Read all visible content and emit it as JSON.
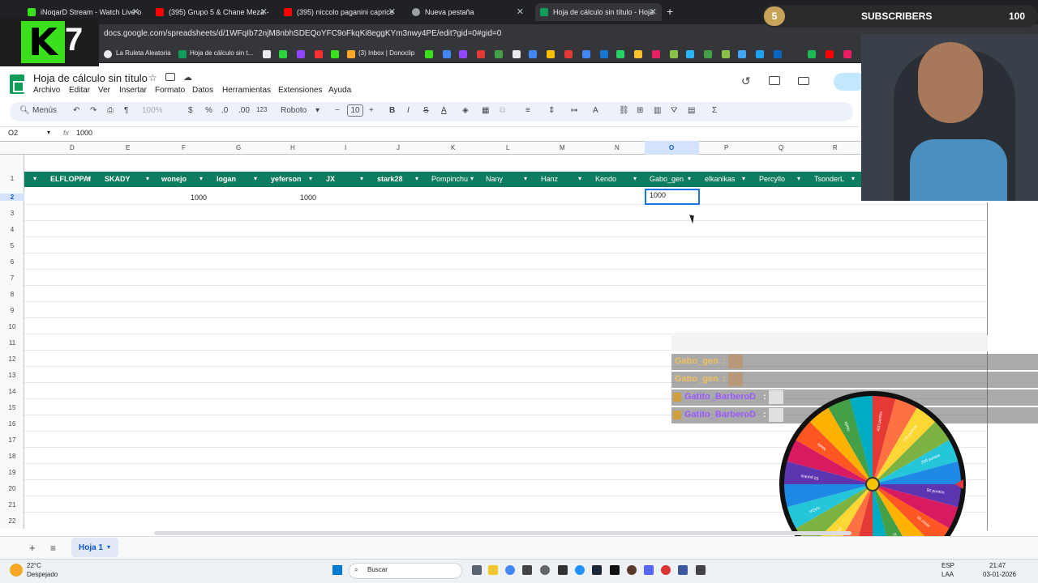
{
  "browser": {
    "tabs": [
      {
        "label": "iNoqarD Stream - Watch Live o",
        "color": "#39e01b"
      },
      {
        "label": "(395) Grupo 5 & Chane Meza -",
        "color": "#ff0000"
      },
      {
        "label": "(395) niccolo paganini caprice",
        "color": "#ff0000"
      },
      {
        "label": "Nueva pestaña",
        "color": "#9aa0a6"
      },
      {
        "label": "Hoja de cálculo sin título - Hoja",
        "color": "#0f9d58"
      }
    ],
    "url": "docs.google.com/spreadsheets/d/1WFqIb72njM8nbhSDEQoYFC9oFkqKi8eggKYm3nwy4PE/edit?gid=0#gid=0",
    "bookmarks": [
      {
        "label": "La Ruleta Aleatoria"
      },
      {
        "label": "Hoja de cálculo sin t..."
      },
      {
        "label": "(3) Inbox | Donoclip"
      }
    ]
  },
  "overlay": {
    "logo_text": "K",
    "logo_number": "7",
    "subscribers_goal": "5",
    "subscribers_label": "SUBSCRIBERS",
    "subscribers_count": "100",
    "chat": [
      {
        "name": "Gabo_gen",
        "color": "#f0c060"
      },
      {
        "name": "Gabo_gen",
        "color": "#f0c060"
      },
      {
        "name": "Gatito_BarberoD",
        "color": "#9b59ff"
      },
      {
        "name": "Gatito_BarberoD",
        "color": "#9b59ff"
      }
    ],
    "wheel_labels": [
      "400 puntos",
      "100 puntos",
      "200 puntos",
      "50 puntos",
      "Mi chela",
      "200 puntos",
      "250 puntos",
      "100 puntos",
      "NADA",
      "50 puntos",
      "Nada",
      "Nada"
    ]
  },
  "sheets": {
    "title": "Hoja de cálculo sin título",
    "menu": [
      "Archivo",
      "Editar",
      "Ver",
      "Insertar",
      "Formato",
      "Datos",
      "Herramientas",
      "Extensiones",
      "Ayuda"
    ],
    "toolbar": {
      "menus_label": "Menús",
      "zoom": "100%",
      "currency": "$",
      "percent": "%",
      "decimals_less": ".0",
      "decimals_more": ".00",
      "format_123": "123",
      "font": "Roboto",
      "font_size": "10",
      "bold": "B",
      "italic": "I",
      "sum": "Σ"
    },
    "name_box": "O2",
    "fx_label": "fx",
    "formula_value": "1000",
    "columns": [
      "D",
      "E",
      "F",
      "G",
      "H",
      "I",
      "J",
      "K",
      "L",
      "M",
      "N",
      "O",
      "P",
      "Q",
      "R"
    ],
    "rows": [
      "1",
      "2",
      "3",
      "4",
      "5",
      "6",
      "7",
      "8",
      "9",
      "10",
      "11",
      "12",
      "13",
      "14",
      "15",
      "16",
      "17",
      "18",
      "19",
      "20",
      "21",
      "22"
    ],
    "header_row": [
      "ELFLOPPAI",
      "SKADY",
      "wonejo",
      "logan",
      "yeferson",
      "JX",
      "stark28",
      "Pompinchu",
      "Nany",
      "Hanz",
      "Kendo",
      "Gabo_gen",
      "elkanikas",
      "Percyllo",
      "TsonderL"
    ],
    "row2_values": {
      "wonejo": "1000",
      "yeferson": "1000"
    },
    "active_cell_value": "1000",
    "sheet_tab": "Hoja 1"
  },
  "taskbar": {
    "weather_temp": "22°C",
    "weather_desc": "Despejado",
    "search_placeholder": "Buscar",
    "lang": "ESP",
    "lang2": "LAA",
    "time": "21:47",
    "date": "03-01-2026"
  }
}
